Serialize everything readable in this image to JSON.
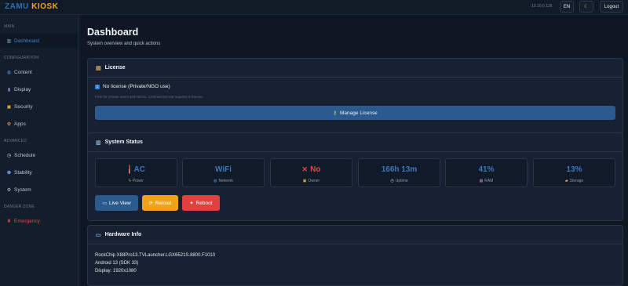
{
  "topbar": {
    "brand_part1": "ZAMU",
    "brand_part2": "KIOSK",
    "ip": "10.10.0.126",
    "lang": "EN",
    "theme_icon": "☾",
    "logout": "Logout"
  },
  "sidebar": {
    "sections": {
      "main": "MAIN",
      "configuration": "CONFIGURATION",
      "advanced": "ADVANCED",
      "danger": "DANGER ZONE"
    },
    "items": [
      {
        "label": "Dashboard",
        "icon": "bar-chart-icon",
        "glyph": "▥"
      },
      {
        "label": "Content",
        "icon": "globe-icon",
        "glyph": "◍"
      },
      {
        "label": "Display",
        "icon": "display-icon",
        "glyph": "▮"
      },
      {
        "label": "Security",
        "icon": "lock-icon",
        "glyph": "▣"
      },
      {
        "label": "Apps",
        "icon": "apps-icon",
        "glyph": "✿"
      },
      {
        "label": "Schedule",
        "icon": "clock-icon",
        "glyph": "◷"
      },
      {
        "label": "Stability",
        "icon": "shield-icon",
        "glyph": "⬟"
      },
      {
        "label": "System",
        "icon": "gear-icon",
        "glyph": "⚙"
      },
      {
        "label": "Emergency",
        "icon": "emergency-icon",
        "glyph": "♜"
      }
    ]
  },
  "page": {
    "title": "Dashboard",
    "subtitle": "System overview and quick actions"
  },
  "license": {
    "title": "License",
    "status": "No license (Private/NGO use)",
    "note": "Free for private users and NGOs. Commercial use requires a license.",
    "button": "Manage License"
  },
  "system_status": {
    "title": "System Status",
    "stats": [
      {
        "value": "AC",
        "label": "Power",
        "value_icon": "plug-icon",
        "label_icon": "bolt-icon",
        "color": "#3b76bb"
      },
      {
        "value": "WiFi",
        "label": "Network",
        "label_icon": "globe-icon",
        "color": "#3b76bb"
      },
      {
        "value": "No",
        "label": "Owner",
        "value_icon": "cross-icon",
        "label_icon": "lock-icon",
        "color": "#e0484b"
      },
      {
        "value": "166h 13m",
        "label": "Uptime",
        "label_icon": "clock-icon",
        "color": "#3b76bb"
      },
      {
        "value": "41%",
        "label": "RAM",
        "label_icon": "memory-icon",
        "color": "#3b76bb"
      },
      {
        "value": "13%",
        "label": "Storage",
        "label_icon": "folder-icon",
        "color": "#3b76bb"
      }
    ],
    "buttons": {
      "live": "Live View",
      "reload": "Reload",
      "reboot": "Reboot"
    }
  },
  "hardware": {
    "title": "Hardware Info",
    "lines": [
      "RockChip X88Pro13.TVLauncher.LGX6521S.8800.F1010",
      "Android 13 (SDK 33)",
      "Display: 1920x1080"
    ]
  },
  "colors": {
    "accent": "#2f6fb3",
    "brand_orange": "#f2a516",
    "danger": "#e14040",
    "warning": "#f0a21a"
  }
}
